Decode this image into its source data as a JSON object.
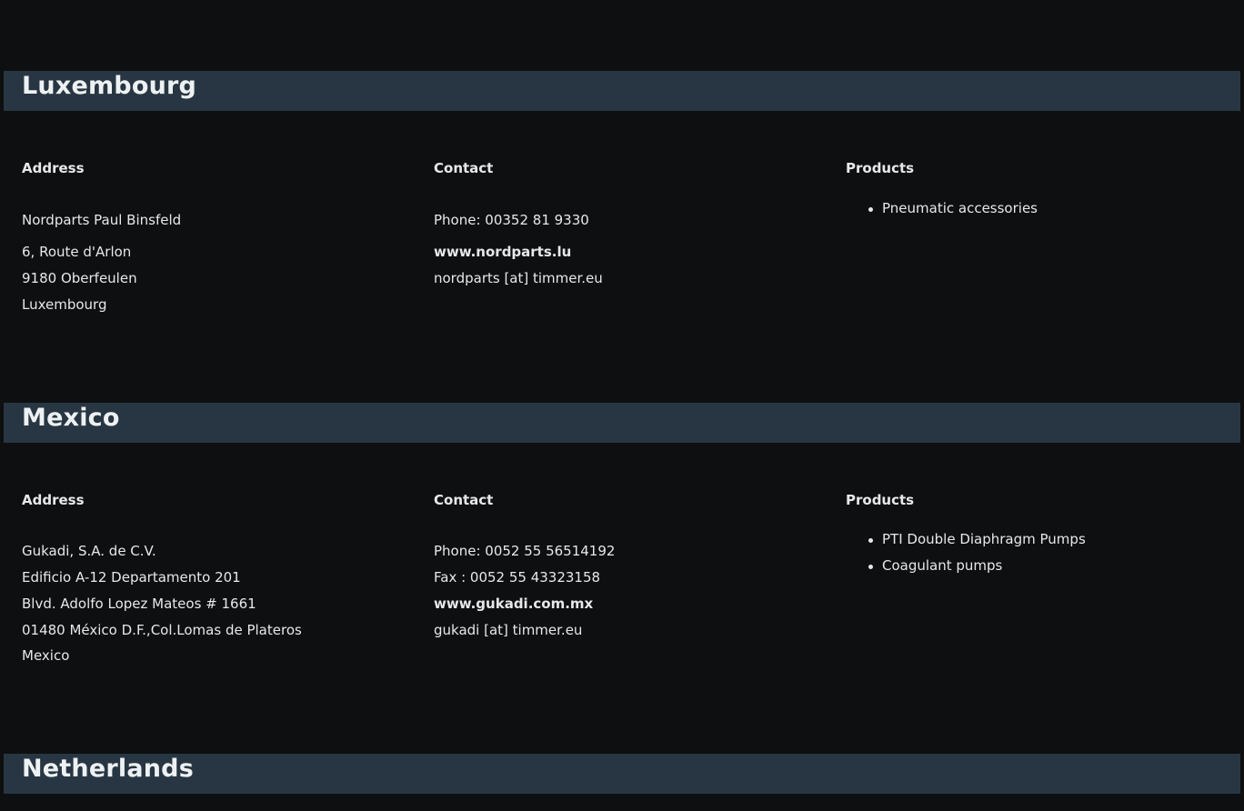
{
  "sections": [
    {
      "country": "Luxembourg",
      "address_heading": "Address",
      "address_lines": [
        "Nordparts Paul Binsfeld",
        "6, Route d'Arlon",
        "9180 Oberfeulen",
        "Luxembourg"
      ],
      "contact_heading": "Contact",
      "phone": "Phone: 00352 81 9330",
      "website": "www.nordparts.lu",
      "email": "nordparts [at] timmer.eu",
      "products_heading": "Products",
      "products": [
        "Pneumatic accessories"
      ]
    },
    {
      "country": "Mexico",
      "address_heading": "Address",
      "address_lines": [
        "Gukadi, S.A. de C.V.",
        "Edificio A-12 Departamento 201",
        "Blvd. Adolfo Lopez Mateos # 1661",
        "01480 México D.F.,Col.Lomas de Plateros",
        "Mexico"
      ],
      "contact_heading": "Contact",
      "phone": "Phone: 0052 55 56514192",
      "fax": "Fax : 0052 55 43323158",
      "website": "www.gukadi.com.mx",
      "email": "gukadi [at] timmer.eu",
      "products_heading": "Products",
      "products": [
        "PTI Double Diaphragm Pumps",
        "Coagulant pumps"
      ]
    },
    {
      "country": "Netherlands"
    }
  ]
}
